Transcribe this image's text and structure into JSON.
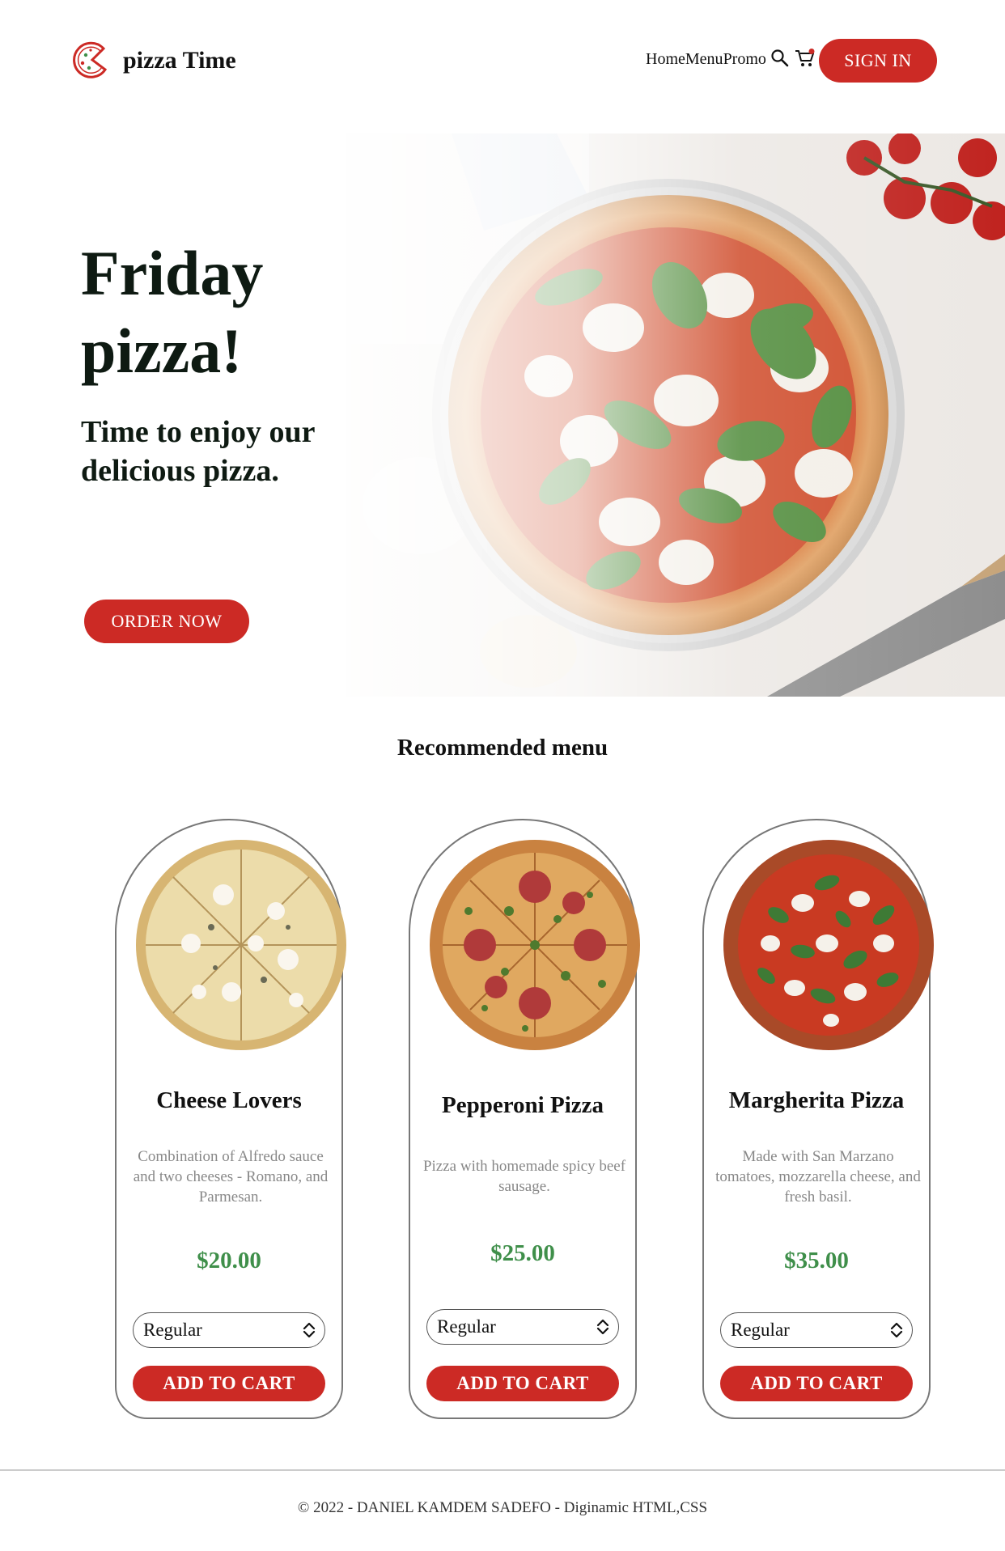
{
  "nav": {
    "brand": "pizza Time",
    "links": [
      "Home",
      "Menu",
      "Promo"
    ],
    "signin_label": "SIGN IN",
    "icons": [
      "search-icon",
      "cart-icon"
    ]
  },
  "hero": {
    "title": "Friday pizza!",
    "subtitle": "Time to enjoy our delicious pizza.",
    "cta_label": "ORDER NOW"
  },
  "menu": {
    "title": "Recommended menu",
    "items": [
      {
        "name": "Cheese Lovers",
        "description": "Combination of Alfredo sauce and two cheeses - Romano, and Parmesan.",
        "price": "$20.00",
        "size": "Regular",
        "button": "ADD TO CART"
      },
      {
        "name": "Pepperoni Pizza",
        "description": "Pizza with homemade spicy beef sausage.",
        "price": "$25.00",
        "size": "Regular",
        "button": "ADD TO CART"
      },
      {
        "name": "Margherita Pizza",
        "description": "Made with San Marzano tomatoes, mozzarella cheese, and fresh basil.",
        "price": "$35.00",
        "size": "Regular",
        "button": "ADD TO CART"
      }
    ]
  },
  "footer": {
    "text": "© 2022 - DANIEL KAMDEM SADEFO - Diginamic HTML,CSS"
  },
  "colors": {
    "accent": "#cc2a25",
    "price": "#3f8f4a",
    "heading": "#0e1a12"
  }
}
